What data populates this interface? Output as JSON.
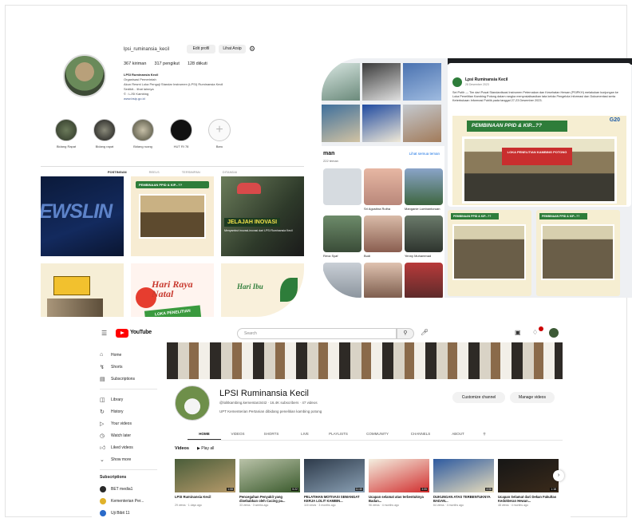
{
  "instagram": {
    "username": "lpsi_ruminansia_kecil",
    "edit_profile": "Edit profil",
    "view_archive": "Lihat Arsip",
    "stats": {
      "posts": "367 kiriman",
      "followers": "317 pengikut",
      "following": "128 diikuti"
    },
    "bio": {
      "name": "LPSI Ruminansia Kecil",
      "category": "Organisasi Pemerintah",
      "lines": [
        "Akun Resmi Loka Penguji Standar Instrumen (LPSI) Ruminansia Kecil",
        "Sedikit... lihat lainnya",
        "© : LJSI Kambing"
      ],
      "link": "www.bsip.go.id"
    },
    "highlights": [
      "Bidang Rapat",
      "Bidang rapat",
      "Bidang ruang",
      "HUT RI 78",
      "Baru"
    ],
    "tabs": [
      "POSTINGAN",
      "REELS",
      "TERSIMPAN",
      "DITANDAI"
    ],
    "tiles": {
      "news": "EWSLIN",
      "pembinaan": "PEMBINAAN PPID & KIP...??",
      "jelajah": "JELAJAH INOVASI",
      "jelajah_sub": "Menyambut inovasi-inovasi dari LPSI Ruminansia Kecil",
      "hariraya": "Hari Raya Natal",
      "hariraya_badge": "LOKA PENELITIAN KAMBING POTONG",
      "haribu": "Hari Ibu"
    }
  },
  "facebook": {
    "page_name": "Lpsi Ruminansia Kecil",
    "post_date": "28 Desember 2023",
    "post_text": "Sei Putih — Tim dari Pusat Standardisasi Instrumen Peternakan dan Kesehatan Hewan (PSIPKH) melakukan kunjungan ke Loka Penelitian Kambing Potong dalam rangka menyosialisasikan tata kelola Pengelola Informasi dan Dokumentasi serta Keterbukaan Informasi Publik pada tanggal 27-23 Desember 2023.",
    "post_header": "PEMBINAAN PPID & KIP...??",
    "banner_text": "LOKA PENELITIAN KAMBING POTONG",
    "g20": "G20",
    "friends_title": "man",
    "friends_count": "222 teman",
    "see_all": "Lihat semua teman",
    "friends": [
      "",
      "Sri Agustina Rutha",
      "Manganie Lumbantoruan",
      "Reva Syaf",
      "Budi",
      "Yenny Muhammad",
      "",
      "",
      ""
    ],
    "thumb_header": "PEMBINAAN PPID & KIP...??"
  },
  "youtube": {
    "logo_text": "YouTube",
    "search_placeholder": "Search",
    "sidebar": {
      "main": [
        "Home",
        "Shorts",
        "Subscriptions"
      ],
      "library": [
        "Library",
        "History",
        "Your videos",
        "Watch later",
        "Liked videos",
        "Show more"
      ],
      "subs_title": "Subscriptions",
      "subs": [
        "BET media1",
        "Kementerian Per...",
        "Uji Bibit 11"
      ]
    },
    "channel": {
      "name": "LPSI Ruminansia Kecil",
      "meta": "@lolitkambing.kementan3442 · 16.4K subscribers · 47 videos",
      "desc": "UPT Kementerian Pertanian dibidang penelitian kambing potong",
      "customize": "Customize channel",
      "manage": "Manage videos"
    },
    "tabs": [
      "HOME",
      "VIDEOS",
      "SHORTS",
      "LIVE",
      "PLAYLISTS",
      "COMMUNITY",
      "CHANNELS",
      "ABOUT"
    ],
    "videos_heading": "Videos",
    "play_all": "▶ Play all",
    "videos": [
      {
        "title": "LPSI Ruminansia Kecil",
        "meta": "29 views · 1 days ago",
        "dur": "1:08"
      },
      {
        "title": "Pencegahan Penyakit yang disebabkan oleh Cacing pa...",
        "meta": "33 views · 3 weeks ago",
        "dur": "5:22"
      },
      {
        "title": "PELATIHAN MOTIVASI SEMANGAT KERJA LOLIT KAMBIN...",
        "meta": "116 views · 3 months ago",
        "dur": "11:40"
      },
      {
        "title": "Ucapan selamat atas terbentuknya Badan...",
        "meta": "96 views · 4 months ago",
        "dur": "3:05"
      },
      {
        "title": "DUKUNGAN ATAS TERBENTUKNYA BADAN...",
        "meta": "64 views · 4 months ago",
        "dur": "4:06"
      },
      {
        "title": "Ucapan Selamat dari Dekan Fakultas Kedokteran Hewan...",
        "meta": "48 views · 4 months ago",
        "dur": "1:18"
      }
    ]
  }
}
